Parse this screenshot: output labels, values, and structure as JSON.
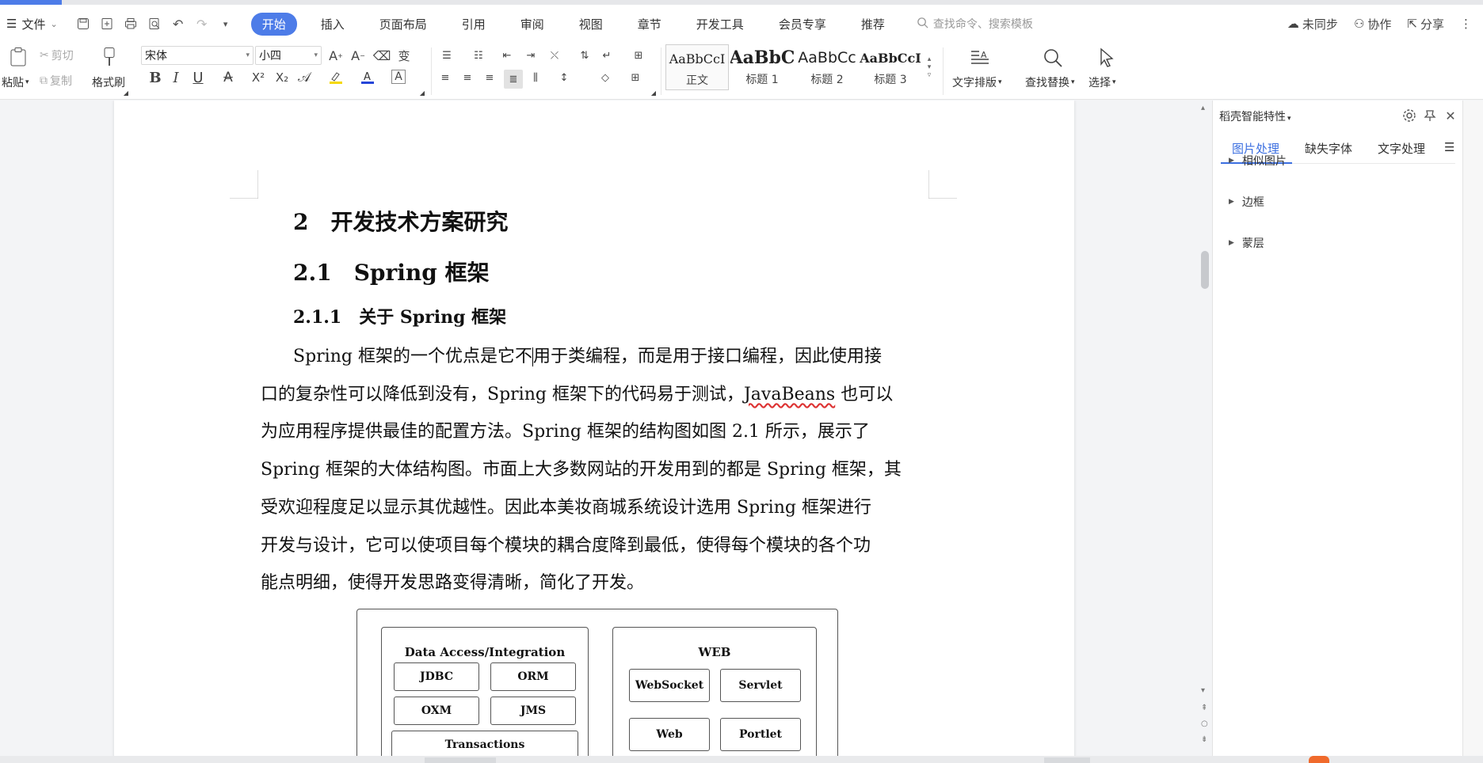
{
  "menubar": {
    "file_label": "文件",
    "tabs": [
      {
        "label": "开始",
        "active": true
      },
      {
        "label": "插入"
      },
      {
        "label": "页面布局"
      },
      {
        "label": "引用"
      },
      {
        "label": "审阅"
      },
      {
        "label": "视图"
      },
      {
        "label": "章节"
      },
      {
        "label": "开发工具"
      },
      {
        "label": "会员专享"
      },
      {
        "label": "推荐"
      }
    ],
    "search_placeholder": "查找命令、搜索模板",
    "sync_label": "未同步",
    "collab_label": "协作",
    "share_label": "分享"
  },
  "ribbon": {
    "paste_label": "粘贴",
    "cut_label": "剪切",
    "copy_label": "复制",
    "format_painter_label": "格式刷",
    "font_name": "宋体",
    "font_size": "小四",
    "styles": [
      {
        "preview": "AaBbCcI",
        "name": "正文"
      },
      {
        "preview": "AaBbC",
        "name": "标题 1"
      },
      {
        "preview": "AaBbCc",
        "name": "标题 2"
      },
      {
        "preview": "AaBbCcI",
        "name": "标题 3"
      }
    ],
    "text_layout_label": "文字排版",
    "find_replace_label": "查找替换",
    "select_label": "选择"
  },
  "document": {
    "heading1": "2　开发技术方案研究",
    "heading2": "2.1　Spring 框架",
    "heading3": "2.1.1　关于 Spring 框架",
    "para_line1_a": "Spring 框架的一个优点是它不",
    "para_line1_b": "用于类编程，而是用于接口编程，因此使用接",
    "para_line2_a": "口的复杂性可以降低到没有，Spring 框架下的代码易于测试，",
    "para_line2_b": "JavaBeans",
    "para_line2_c": " 也可以",
    "para_line3": "为应用程序提供最佳的配置方法。Spring 框架的结构图如图 2.1 所示，展示了",
    "para_line4": "Spring 框架的大体结构图。市面上大多数网站的开发用到的都是 Spring 框架，其",
    "para_line5": "受欢迎程度足以显示其优越性。因此本美妆商城系统设计选用 Spring 框架进行",
    "para_line6": "开发与设计，它可以使项目每个模块的耦合度降到最低，使得每个模块的各个功",
    "para_line7": "能点明细，使得开发思路变得清晰，简化了开发。"
  },
  "diagram": {
    "data_access_title": "Data Access/Integration",
    "jdbc": "JDBC",
    "orm": "ORM",
    "oxm": "OXM",
    "jms": "JMS",
    "transactions": "Transactions",
    "web_title": "WEB",
    "websocket": "WebSocket",
    "servlet": "Servlet",
    "web": "Web",
    "portlet": "Portlet"
  },
  "panel": {
    "title": "稻壳智能特性",
    "tabs": [
      "图片处理",
      "缺失字体",
      "文字处理"
    ],
    "items": [
      "相似图片",
      "边框",
      "蒙层"
    ]
  }
}
